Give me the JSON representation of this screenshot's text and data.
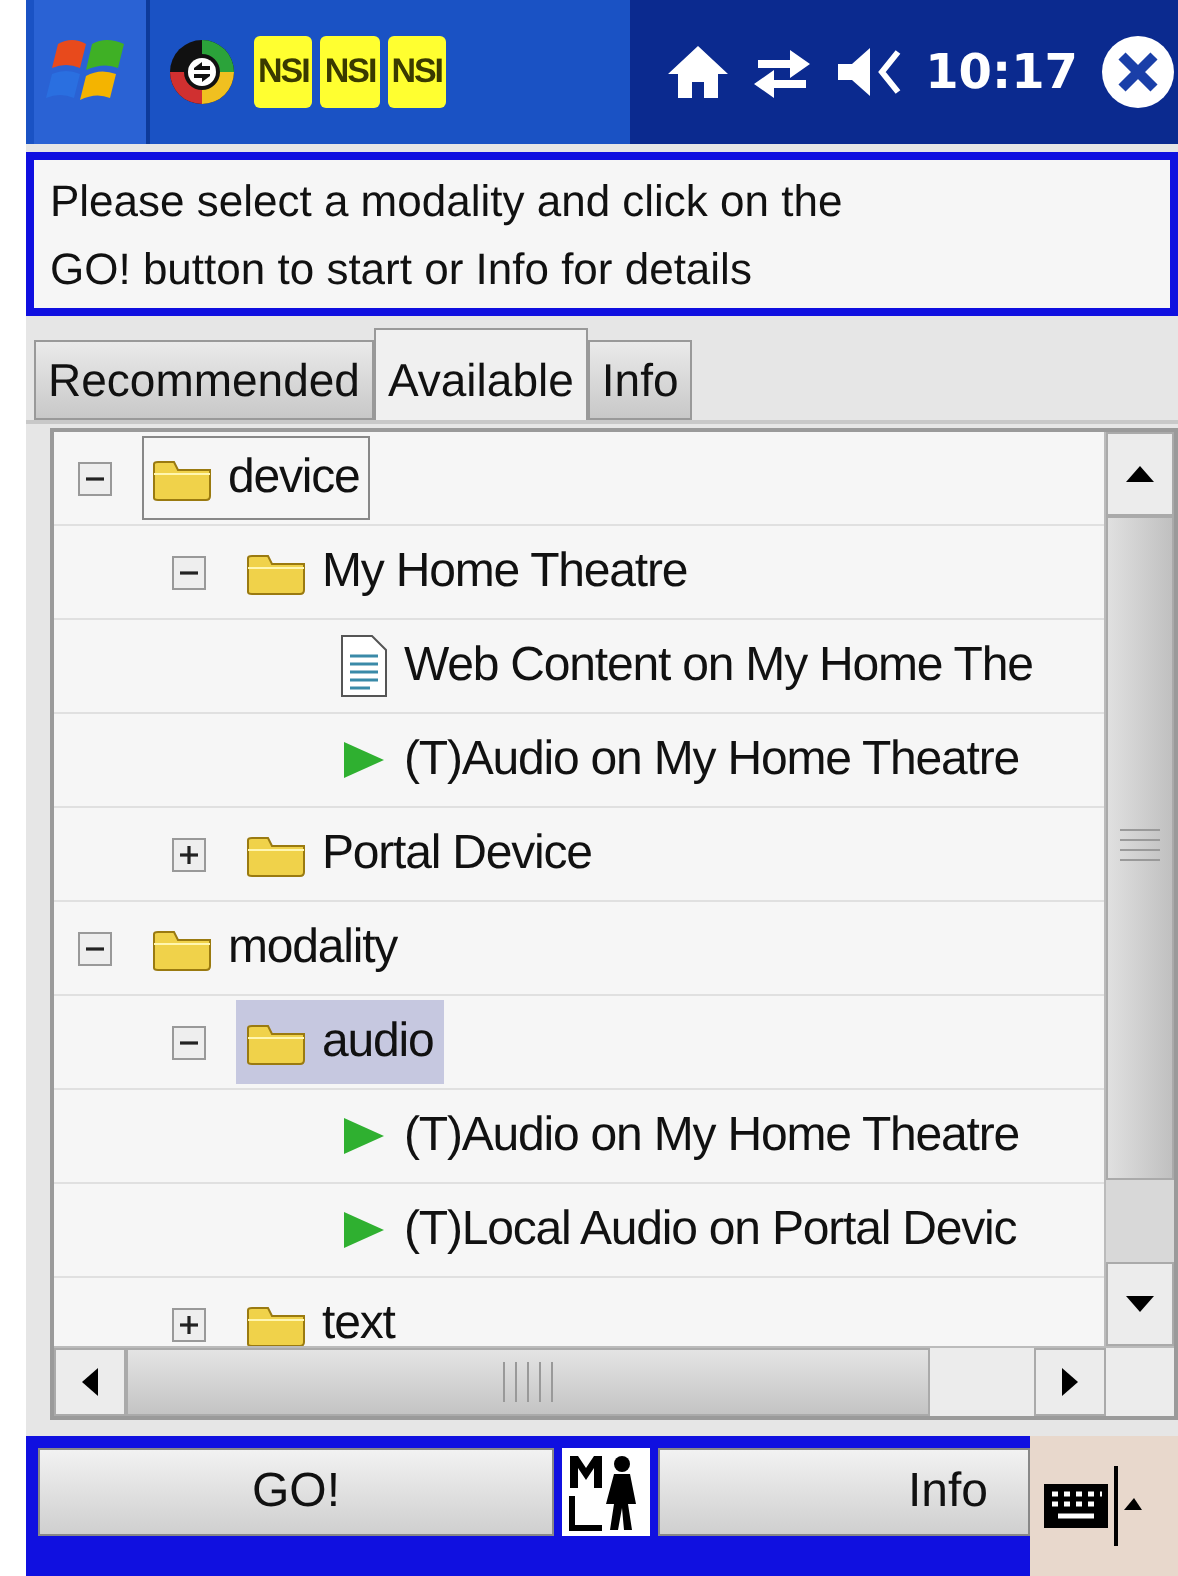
{
  "taskbar": {
    "app_icons": [
      "NSI",
      "NSI",
      "NSI"
    ],
    "time": "10:17"
  },
  "message": "Please select a modality and click on the GO! button to start or Info for details",
  "tabs": [
    {
      "label": "Recommended",
      "selected": false
    },
    {
      "label": "Available",
      "selected": true
    },
    {
      "label": "Info",
      "selected": false
    }
  ],
  "tree": [
    {
      "kind": "folder",
      "label": "device",
      "expanded": true,
      "selected": false,
      "focused": true,
      "children": [
        {
          "kind": "folder",
          "label": "My Home Theatre",
          "expanded": true,
          "selected": false,
          "focused": false,
          "children": [
            {
              "kind": "document",
              "label": "Web Content on My Home The",
              "selected": false,
              "focused": false
            },
            {
              "kind": "play",
              "label": "(T)Audio on My Home Theatre",
              "selected": false,
              "focused": false
            }
          ]
        },
        {
          "kind": "folder",
          "label": "Portal Device",
          "expanded": false,
          "selected": false,
          "focused": false
        }
      ]
    },
    {
      "kind": "folder",
      "label": "modality",
      "expanded": true,
      "selected": false,
      "focused": false,
      "children": [
        {
          "kind": "folder",
          "label": "audio",
          "expanded": true,
          "selected": true,
          "focused": false,
          "children": [
            {
              "kind": "play",
              "label": "(T)Audio on My Home Theatre",
              "selected": false,
              "focused": false
            },
            {
              "kind": "play",
              "label": "(T)Local Audio on Portal Devic",
              "selected": false,
              "focused": false
            }
          ]
        },
        {
          "kind": "folder",
          "label": "text",
          "expanded": false,
          "selected": false,
          "focused": false
        }
      ]
    }
  ],
  "buttons": [
    "GO!",
    "Info"
  ]
}
